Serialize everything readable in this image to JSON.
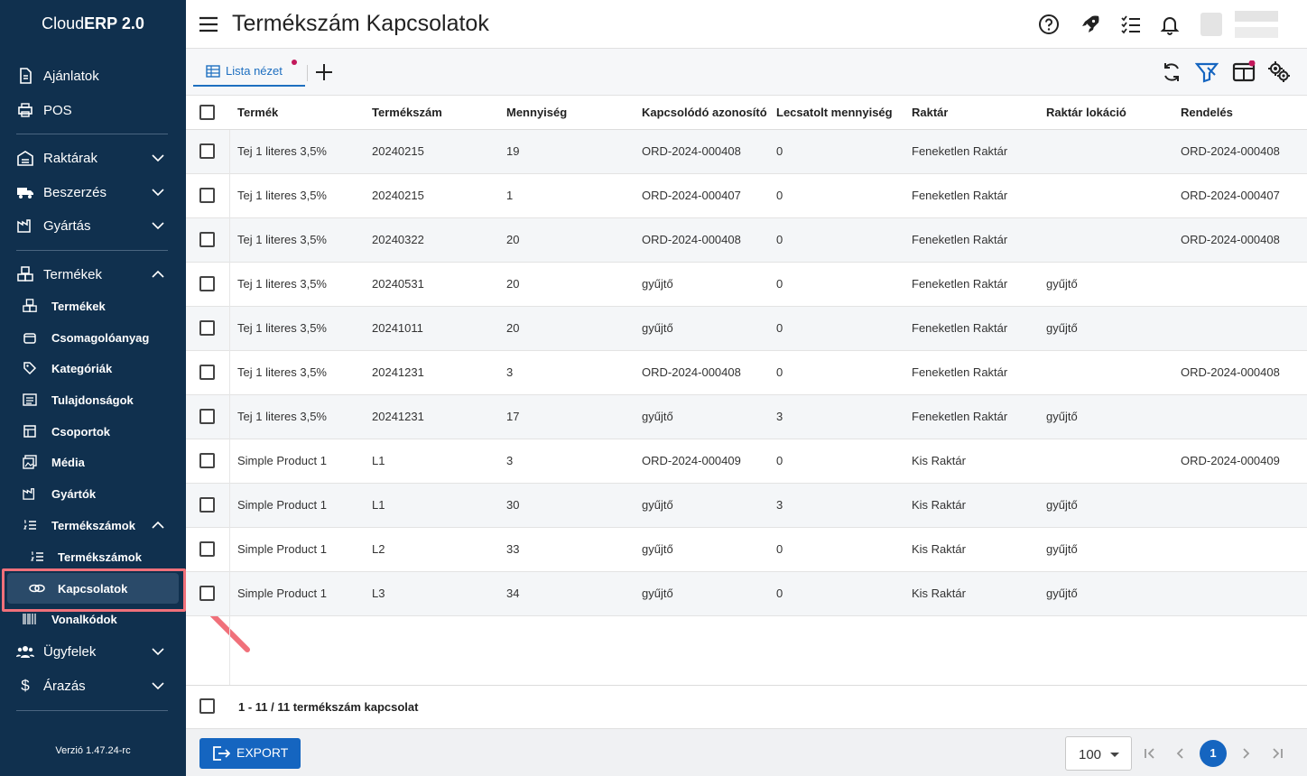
{
  "app": {
    "brand_prefix": "Cloud",
    "brand_bold": "ERP 2.0",
    "version": "Verzió 1.47.24-rc"
  },
  "sidebar": {
    "items": [
      {
        "label": "Ajánlatok",
        "icon": "document-icon"
      },
      {
        "label": "POS",
        "icon": "printer-icon"
      },
      {
        "label": "Raktárak",
        "icon": "warehouse-icon",
        "expandable": true
      },
      {
        "label": "Beszerzés",
        "icon": "truck-icon",
        "expandable": true
      },
      {
        "label": "Gyártás",
        "icon": "factory-icon",
        "expandable": true
      },
      {
        "label": "Termékek",
        "icon": "boxes-icon",
        "expanded": true
      },
      {
        "label": "Ügyfelek",
        "icon": "people-icon",
        "expandable": true
      },
      {
        "label": "Árazás",
        "icon": "dollar-icon",
        "expandable": true
      }
    ],
    "termekek_children": [
      {
        "label": "Termékek",
        "icon": "boxes-icon"
      },
      {
        "label": "Csomagolóanyag",
        "icon": "package-icon"
      },
      {
        "label": "Kategóriák",
        "icon": "tag-icon"
      },
      {
        "label": "Tulajdonságok",
        "icon": "list-icon"
      },
      {
        "label": "Csoportok",
        "icon": "group-icon"
      },
      {
        "label": "Média",
        "icon": "media-icon"
      },
      {
        "label": "Gyártók",
        "icon": "factory-icon"
      },
      {
        "label": "Termékszámok",
        "icon": "numbered-list-icon",
        "expanded": true
      }
    ],
    "termekszamok_children": [
      {
        "label": "Termékszámok",
        "icon": "numbered-list-icon"
      },
      {
        "label": "Kapcsolatok",
        "icon": "link-icon",
        "active": true
      }
    ],
    "after_termekszamok": {
      "label": "Vonalkódok",
      "icon": "barcode-icon"
    }
  },
  "header": {
    "title": "Termékszám Kapcsolatok",
    "icons": [
      "help-icon",
      "rocket-icon",
      "checklist-icon",
      "bell-icon"
    ]
  },
  "toolbar": {
    "tab_label": "Lista nézet",
    "right_icons": [
      "refresh-icon",
      "filter-icon",
      "columns-icon",
      "settings-icon"
    ]
  },
  "table": {
    "columns": [
      "Termék",
      "Termékszám",
      "Mennyiség",
      "Kapcsolódó azonosító",
      "Lecsatolt mennyiség",
      "Raktár",
      "Raktár lokáció",
      "Rendelés"
    ],
    "rows": [
      [
        "Tej 1 literes 3,5%",
        "20240215",
        "19",
        "ORD-2024-000408",
        "0",
        "Feneketlen Raktár",
        "",
        "ORD-2024-000408"
      ],
      [
        "Tej 1 literes 3,5%",
        "20240215",
        "1",
        "ORD-2024-000407",
        "0",
        "Feneketlen Raktár",
        "",
        "ORD-2024-000407"
      ],
      [
        "Tej 1 literes 3,5%",
        "20240322",
        "20",
        "ORD-2024-000408",
        "0",
        "Feneketlen Raktár",
        "",
        "ORD-2024-000408"
      ],
      [
        "Tej 1 literes 3,5%",
        "20240531",
        "20",
        "gyűjtő",
        "0",
        "Feneketlen Raktár",
        "gyűjtő",
        ""
      ],
      [
        "Tej 1 literes 3,5%",
        "20241011",
        "20",
        "gyűjtő",
        "0",
        "Feneketlen Raktár",
        "gyűjtő",
        ""
      ],
      [
        "Tej 1 literes 3,5%",
        "20241231",
        "3",
        "ORD-2024-000408",
        "0",
        "Feneketlen Raktár",
        "",
        "ORD-2024-000408"
      ],
      [
        "Tej 1 literes 3,5%",
        "20241231",
        "17",
        "gyűjtő",
        "3",
        "Feneketlen Raktár",
        "gyűjtő",
        ""
      ],
      [
        "Simple Product 1",
        "L1",
        "3",
        "ORD-2024-000409",
        "0",
        "Kis Raktár",
        "",
        "ORD-2024-000409"
      ],
      [
        "Simple Product 1",
        "L1",
        "30",
        "gyűjtő",
        "3",
        "Kis Raktár",
        "gyűjtő",
        ""
      ],
      [
        "Simple Product 1",
        "L2",
        "33",
        "gyűjtő",
        "0",
        "Kis Raktár",
        "gyűjtő",
        ""
      ],
      [
        "Simple Product 1",
        "L3",
        "34",
        "gyűjtő",
        "0",
        "Kis Raktár",
        "gyűjtő",
        ""
      ]
    ],
    "footer": "1 - 11 / 11 termékszám kapcsolat"
  },
  "bottom": {
    "export_label": "EXPORT",
    "per_page": "100",
    "current_page": "1"
  },
  "colors": {
    "sidebar_bg": "#10304e",
    "accent": "#1565c0",
    "highlight": "#f0707a"
  }
}
